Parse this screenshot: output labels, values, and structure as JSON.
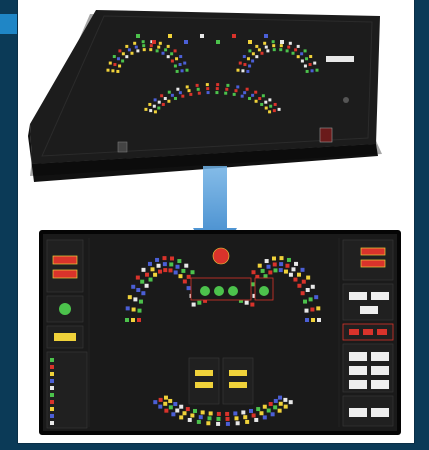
{
  "colors": {
    "background": "#0b3a57",
    "accent": "#1f86c6",
    "arrow": "#3a86c8",
    "panel_body": "#1b1b1b",
    "lamp_green": "#4cc24c",
    "lamp_red": "#d9332b",
    "lamp_yellow": "#f0d23a",
    "lamp_blue": "#4b5fd6",
    "lamp_white": "#e8e8e8"
  },
  "icons": {
    "arrow": "down-arrow-icon"
  }
}
